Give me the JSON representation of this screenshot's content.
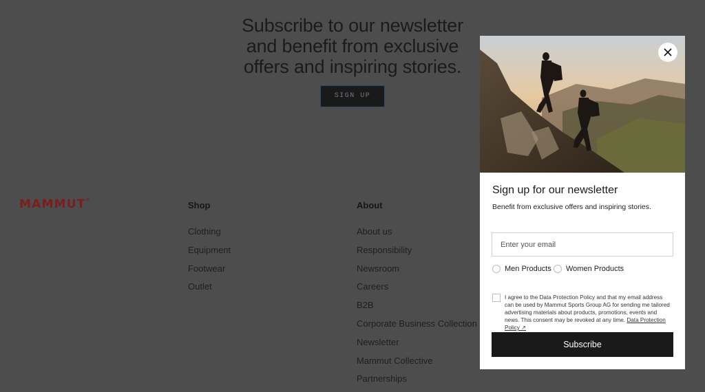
{
  "hero": {
    "title": "Subscribe to our newsletter and benefit from exclusive offers and inspiring stories.",
    "button_label": "SIGN UP"
  },
  "footer": {
    "logo": "MAMMUT",
    "logo_mark": "®",
    "columns": [
      {
        "heading": "Shop",
        "links": [
          "Clothing",
          "Equipment",
          "Footwear",
          "Outlet"
        ]
      },
      {
        "heading": "About",
        "links": [
          "About us",
          "Responsibility",
          "Newsroom",
          "Careers",
          "B2B",
          "Corporate Business Collection",
          "Newsletter",
          "Mammut Collective",
          "Partnerships"
        ]
      }
    ]
  },
  "modal": {
    "image_icon": "hikers-mountain-photo",
    "close_icon": "close-icon",
    "title": "Sign up for our newsletter",
    "subtitle": "Benefit from exclusive offers and inspiring stories.",
    "email_placeholder": "Enter your email",
    "radio_options": [
      "Men Products",
      "Women Products"
    ],
    "consent_text": "I agree to the Data Protection Policy and that my email address can be used by Mammut Sports Group AG for sending me tailored advertising materials about products, promotions, events and news. This consent may be revoked at any time.",
    "consent_link": "Data Protection Policy ↗",
    "subscribe_label": "Subscribe"
  },
  "colors": {
    "overlay_bg": "#4d4d4d",
    "brand_red": "#7c1d1d",
    "button_dark": "#1a1a1a"
  }
}
